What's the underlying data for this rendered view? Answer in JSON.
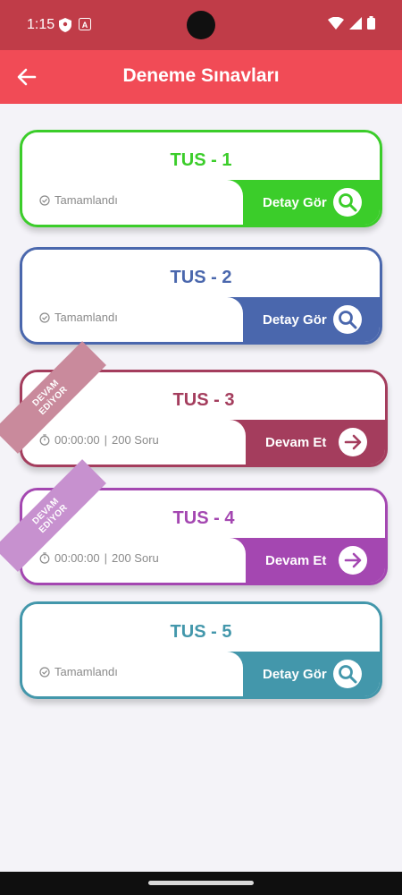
{
  "status_bar": {
    "time": "1:15"
  },
  "app_bar": {
    "title": "Deneme Sınavları"
  },
  "cards": [
    {
      "title": "TUS - 1",
      "status": "Tamamlandı",
      "action": "Detay Gör",
      "color": "#3bcd2a",
      "ribbon": null
    },
    {
      "title": "TUS - 2",
      "status": "Tamamlandı",
      "action": "Detay Gör",
      "color": "#4a67ad",
      "ribbon": null
    },
    {
      "title": "TUS - 3",
      "timer": "00:00:00",
      "questions": "200 Soru",
      "action": "Devam Et",
      "color": "#a43d5d",
      "ribbon": {
        "line1": "DEVAM",
        "line2": "EDİYOR",
        "color": "#c98a9c"
      }
    },
    {
      "title": "TUS - 4",
      "timer": "00:00:00",
      "questions": "200 Soru",
      "action": "Devam Et",
      "color": "#a447b1",
      "ribbon": {
        "line1": "DEVAM",
        "line2": "EDİYOR",
        "color": "#c791cf"
      }
    },
    {
      "title": "TUS - 5",
      "status": "Tamamlandı",
      "action": "Detay Gör",
      "color": "#4397ab",
      "ribbon": null
    }
  ]
}
